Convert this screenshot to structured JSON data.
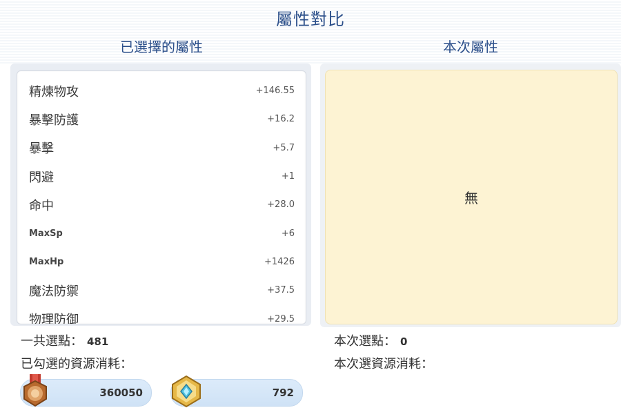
{
  "header": {
    "title": "屬性對比",
    "selected_label": "已選擇的屬性",
    "current_label": "本次屬性"
  },
  "selected_attributes": [
    {
      "name": "精煉物攻",
      "value": "+146.55"
    },
    {
      "name": "暴擊防護",
      "value": "+16.2"
    },
    {
      "name": "暴擊",
      "value": "+5.7"
    },
    {
      "name": "閃避",
      "value": "+1"
    },
    {
      "name": "命中",
      "value": "+28.0"
    },
    {
      "name": "MaxSp",
      "value": "+6"
    },
    {
      "name": "MaxHp",
      "value": "+1426"
    },
    {
      "name": "魔法防禦",
      "value": "+37.5"
    },
    {
      "name": "物理防御",
      "value": "+29.5"
    }
  ],
  "current": {
    "empty_text": "無",
    "points_label": "本次選點：",
    "points_value": "0",
    "cost_label": "本次選資源消耗："
  },
  "summary": {
    "points_label": "一共選點：",
    "points_value": "481",
    "cost_label": "已勾選的資源消耗："
  },
  "resources": [
    {
      "icon": "bronze-medal-icon",
      "value": "360050"
    },
    {
      "icon": "gold-crystal-icon",
      "value": "792"
    }
  ],
  "colors": {
    "title": "#2b4f8a",
    "current_box": "#fdf3d3",
    "resource_pill": "#cfe2f6"
  }
}
